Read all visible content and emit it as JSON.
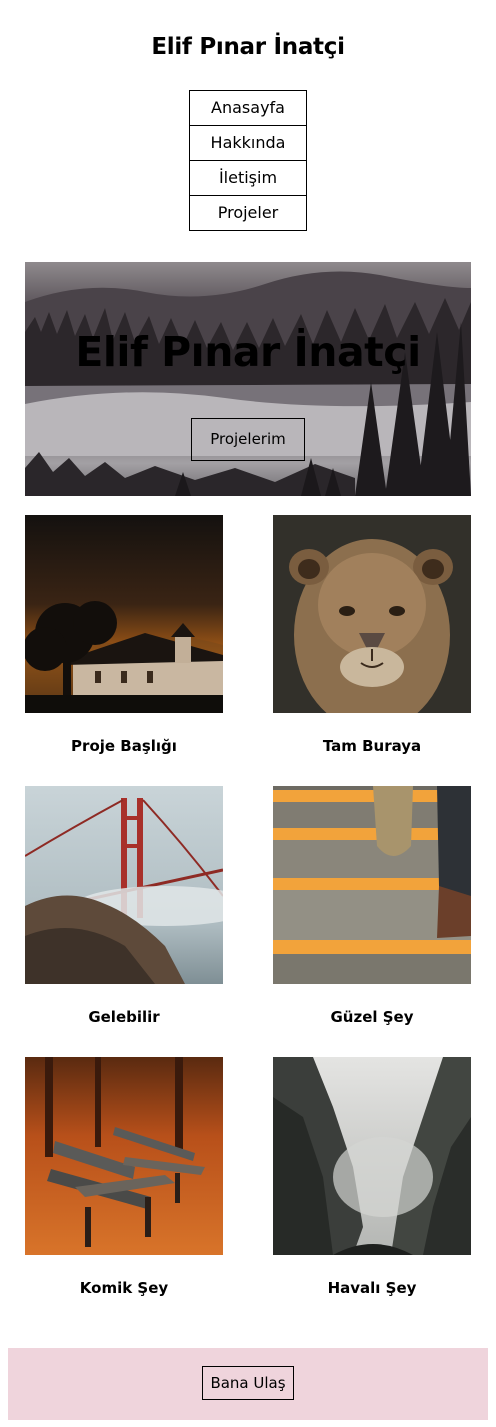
{
  "header": {
    "site_title": "Elif Pınar İnatçi"
  },
  "nav": {
    "items": [
      {
        "label": "Anasayfa"
      },
      {
        "label": "Hakkında"
      },
      {
        "label": "İletişim"
      },
      {
        "label": "Projeler"
      }
    ]
  },
  "hero": {
    "title": "Elif Pınar İnatçi",
    "button_label": "Projelerim"
  },
  "projects": [
    {
      "caption": "Proje Başlığı",
      "image": "church-at-dusk-photo"
    },
    {
      "caption": "Tam Buraya",
      "image": "lioness-portrait-photo"
    },
    {
      "caption": "Gelebilir",
      "image": "golden-gate-bridge-fog-photo"
    },
    {
      "caption": "Güzel Şey",
      "image": "stairs-sneakers-photo"
    },
    {
      "caption": "Komik Şey",
      "image": "autumn-benches-photo"
    },
    {
      "caption": "Havalı Şey",
      "image": "misty-canyon-photo"
    }
  ],
  "footer": {
    "button_label": "Bana Ulaş",
    "background": "#efd4dc"
  }
}
